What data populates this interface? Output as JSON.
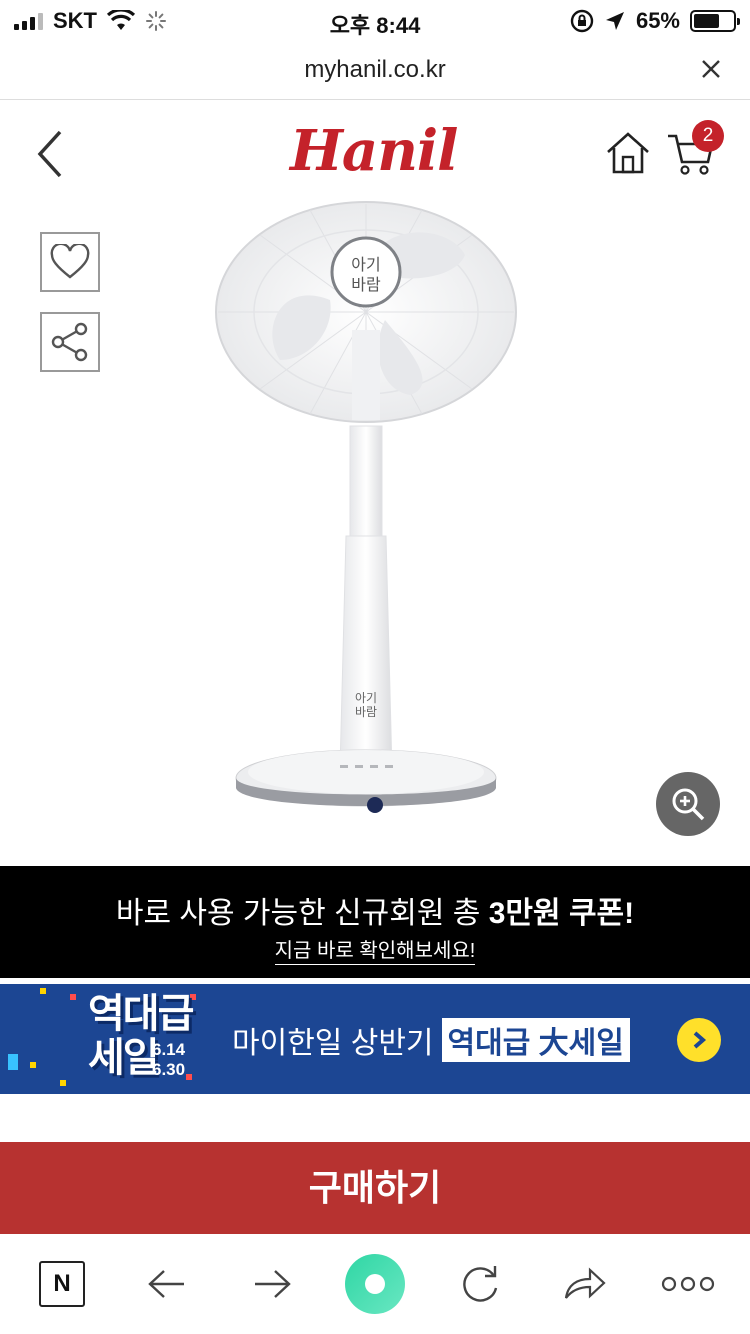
{
  "status_bar": {
    "carrier": "SKT",
    "time": "오후 8:44",
    "battery_percent": "65%",
    "battery_level": 0.65
  },
  "url_bar": {
    "url": "myhanil.co.kr"
  },
  "header": {
    "logo_text": "Hanil",
    "cart_count": "2"
  },
  "product": {
    "badge_text_top": "아기",
    "badge_text_bottom": "바람"
  },
  "promo_banner": {
    "line1_prefix": "바로 사용 가능한 신규회원 총",
    "line1_highlight": "3만원 쿠폰!",
    "line2": "지금 바로 확인해보세요!"
  },
  "sale_banner": {
    "badge_title_1": "역대급",
    "badge_title_2": "세일",
    "date_start": "6.14",
    "date_end": "6.30",
    "text": "마이한일 상반기",
    "highlight": "역대급 大세일"
  },
  "buy_button": {
    "label": "구매하기"
  },
  "colors": {
    "brand_red": "#c4222a",
    "buy_red": "#b73230",
    "sale_blue": "#1c4693",
    "arrow_yellow": "#ffe02a"
  },
  "icons": [
    "back-icon",
    "home-icon",
    "cart-icon",
    "heart-icon",
    "share-icon",
    "zoom-in-icon",
    "close-icon",
    "arrow-left-icon",
    "arrow-right-icon",
    "refresh-icon",
    "share-forward-icon",
    "more-icon"
  ]
}
